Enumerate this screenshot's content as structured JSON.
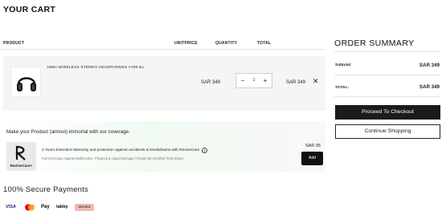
{
  "page": {
    "title": "YOUR CART"
  },
  "cart_table": {
    "headers": {
      "product": "PRODUCT",
      "unit_price": "UNITPRICE",
      "quantity": "QUANTITY",
      "total": "TOTAL"
    },
    "items": [
      {
        "name": "AWEI WIRELESS STEREO HEADPHONES A790 BL",
        "unit_price": "SAR 349",
        "quantity": "1",
        "total": "SAR 349",
        "minus_label": "−",
        "plus_label": "+",
        "remove_label": "✕",
        "image_icon": "headphones-icon"
      }
    ]
  },
  "warranty": {
    "title": "Make your Product (almost) immortal with our coverage.",
    "logo_text": "ReviveCare+",
    "description": "2 Years Extended Warranty and protection against accidents & breakdowns with ReviveCare",
    "info_label": "i",
    "sub": "Full Coverage Against Malfunction, Physical & Liquid Damage | Repair By Certified Technicians",
    "price": "SAR 95",
    "add_label": "Add"
  },
  "payments": {
    "title": "100% Secure Payments",
    "methods": [
      "VISA",
      "Mastercard",
      "Pay",
      "tabby",
      "tamara"
    ],
    "apple_glyph": "",
    "colors": {
      "visa": "#1a1f71",
      "mc_red": "#eb001b",
      "mc_orange": "#f79e1b",
      "tamara_bg": "#f4b9b1"
    }
  },
  "summary": {
    "title": "ORDER SUMMARY",
    "subtotal_label": "Subtotal",
    "subtotal_value": "SAR 349",
    "total_label": "TOTAL:",
    "total_value": "SAR 349",
    "checkout_label": "Proceed To Checkout",
    "continue_label": "Continue Shopping"
  }
}
